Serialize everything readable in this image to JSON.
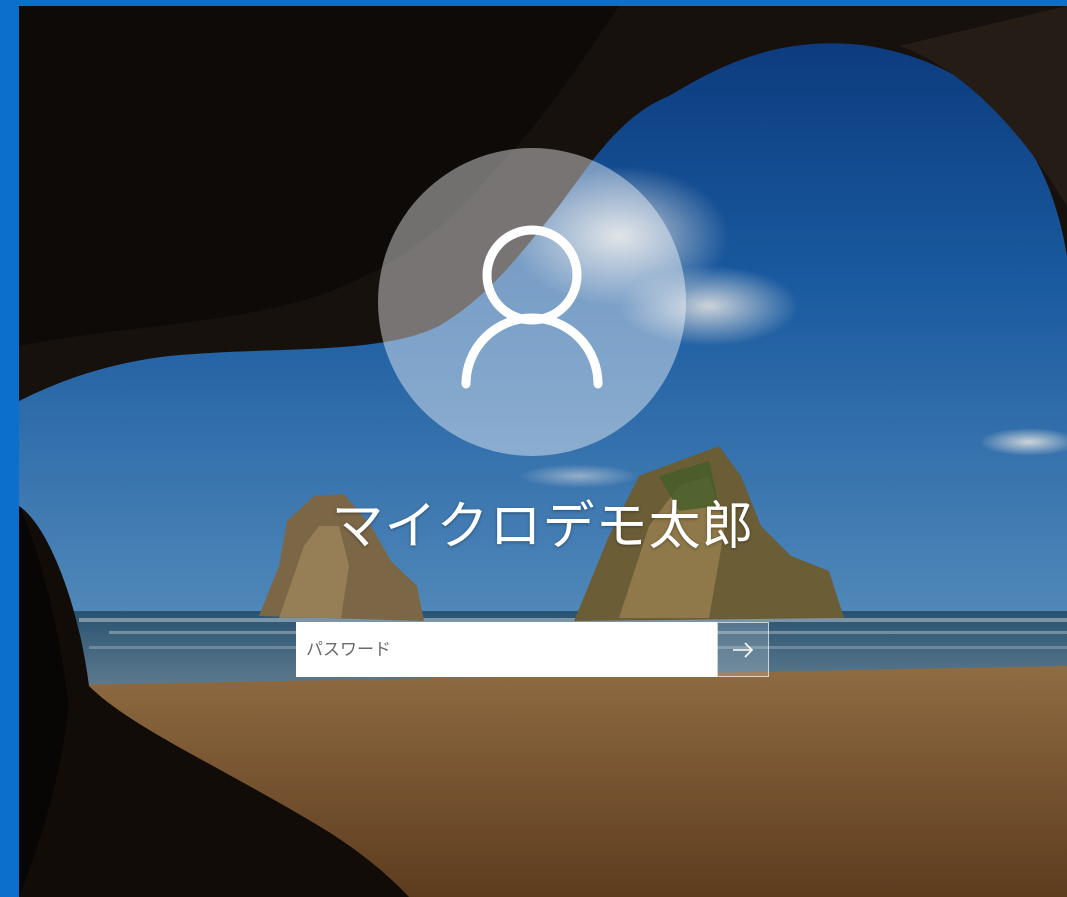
{
  "colors": {
    "frame_accent": "#0b6fcb",
    "avatar_circle": "rgba(255,255,255,0.42)",
    "text": "#ffffff"
  },
  "user": {
    "display_name": "マイクロデモ太郎",
    "avatar_icon": "person-outline-icon"
  },
  "password": {
    "placeholder": "パスワード",
    "value": ""
  },
  "submit": {
    "icon": "arrow-right-icon"
  }
}
